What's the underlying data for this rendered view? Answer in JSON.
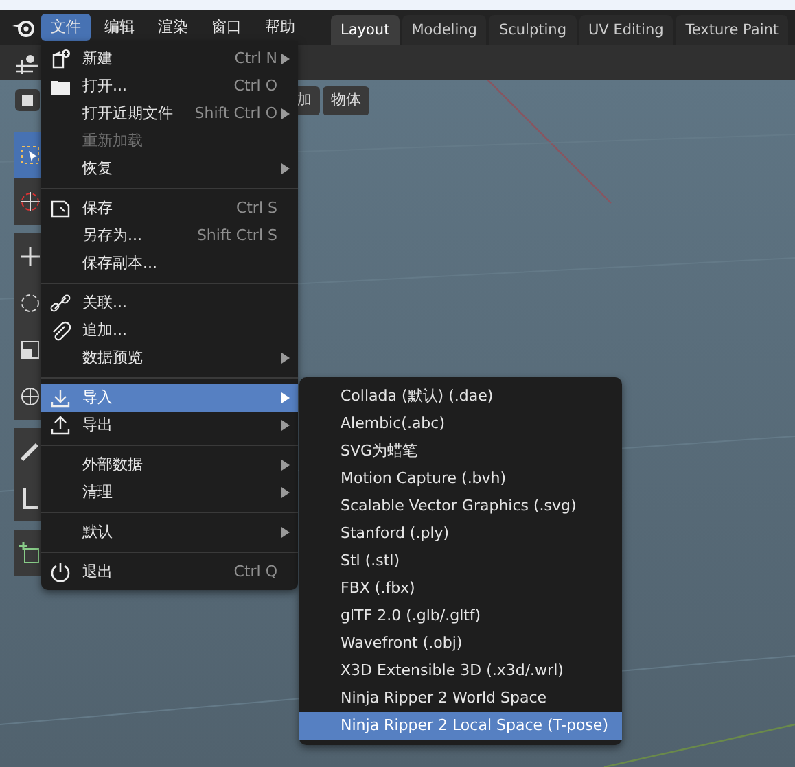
{
  "menubar": {
    "items": [
      {
        "label": "文件",
        "selected": true
      },
      {
        "label": "编辑",
        "selected": false
      },
      {
        "label": "渲染",
        "selected": false
      },
      {
        "label": "窗口",
        "selected": false
      },
      {
        "label": "帮助",
        "selected": false
      }
    ]
  },
  "workspace_tabs": [
    {
      "label": "Layout",
      "selected": true
    },
    {
      "label": "Modeling",
      "selected": false
    },
    {
      "label": "Sculpting",
      "selected": false
    },
    {
      "label": "UV Editing",
      "selected": false
    },
    {
      "label": "Texture Paint",
      "selected": false
    }
  ],
  "viewport_header": {
    "buttons": [
      "加",
      "物体"
    ]
  },
  "toolbar": {
    "tools": [
      {
        "kind": "select",
        "selected": true
      },
      {
        "kind": "cursor",
        "selected": false
      },
      {
        "kind": "move",
        "selected": false
      },
      {
        "kind": "rotate",
        "selected": false
      },
      {
        "kind": "scale",
        "selected": false
      },
      {
        "kind": "transform",
        "selected": false
      },
      {
        "kind": "annotate",
        "selected": false
      },
      {
        "kind": "measure",
        "selected": false
      },
      {
        "kind": "add",
        "selected": false
      }
    ]
  },
  "file_menu": {
    "groups": [
      [
        {
          "label": "新建",
          "shortcut": "Ctrl N",
          "kind": "new",
          "submenu": true,
          "disabled": false,
          "selected": false
        },
        {
          "label": "打开...",
          "shortcut": "Ctrl O",
          "kind": "open",
          "submenu": false,
          "disabled": false,
          "selected": false
        },
        {
          "label": "打开近期文件",
          "shortcut": "Shift Ctrl O",
          "kind": "plain",
          "submenu": true,
          "disabled": false,
          "selected": false
        },
        {
          "label": "重新加载",
          "kind": "plain",
          "disabled": true,
          "submenu": false,
          "selected": false
        },
        {
          "label": "恢复",
          "kind": "plain",
          "submenu": true,
          "disabled": false,
          "selected": false
        }
      ],
      [
        {
          "label": "保存",
          "shortcut": "Ctrl S",
          "kind": "save",
          "submenu": false,
          "disabled": false,
          "selected": false
        },
        {
          "label": "另存为...",
          "shortcut": "Shift Ctrl S",
          "kind": "plain",
          "submenu": false,
          "disabled": false,
          "selected": false
        },
        {
          "label": "保存副本...",
          "kind": "plain",
          "submenu": false,
          "disabled": false,
          "selected": false
        }
      ],
      [
        {
          "label": "关联...",
          "kind": "link",
          "submenu": false,
          "disabled": false,
          "selected": false
        },
        {
          "label": "追加...",
          "kind": "attach",
          "submenu": false,
          "disabled": false,
          "selected": false
        },
        {
          "label": "数据预览",
          "kind": "plain",
          "submenu": true,
          "disabled": false,
          "selected": false
        }
      ],
      [
        {
          "label": "导入",
          "kind": "import",
          "submenu": true,
          "disabled": false,
          "selected": true
        },
        {
          "label": "导出",
          "kind": "export",
          "submenu": true,
          "disabled": false,
          "selected": false
        }
      ],
      [
        {
          "label": "外部数据",
          "kind": "plain",
          "submenu": true,
          "disabled": false,
          "selected": false
        },
        {
          "label": "清理",
          "kind": "plain",
          "submenu": true,
          "disabled": false,
          "selected": false
        }
      ],
      [
        {
          "label": "默认",
          "kind": "plain",
          "submenu": true,
          "disabled": false,
          "selected": false
        }
      ],
      [
        {
          "label": "退出",
          "shortcut": "Ctrl Q",
          "kind": "quit",
          "submenu": false,
          "disabled": false,
          "selected": false
        }
      ]
    ]
  },
  "import_submenu": {
    "items": [
      {
        "label": "Collada (默认) (.dae)",
        "selected": false
      },
      {
        "label": "Alembic(.abc)",
        "selected": false
      },
      {
        "label": "SVG为蜡笔",
        "selected": false
      },
      {
        "label": "Motion Capture (.bvh)",
        "selected": false
      },
      {
        "label": "Scalable Vector Graphics (.svg)",
        "selected": false
      },
      {
        "label": "Stanford (.ply)",
        "selected": false
      },
      {
        "label": "Stl (.stl)",
        "selected": false
      },
      {
        "label": "FBX (.fbx)",
        "selected": false
      },
      {
        "label": "glTF 2.0 (.glb/.gltf)",
        "selected": false
      },
      {
        "label": "Wavefront (.obj)",
        "selected": false
      },
      {
        "label": "X3D Extensible 3D (.x3d/.wrl)",
        "selected": false
      },
      {
        "label": "Ninja Ripper 2 World Space",
        "selected": false
      },
      {
        "label": "Ninja Ripper 2 Local Space (T-pose)",
        "selected": true
      }
    ]
  }
}
